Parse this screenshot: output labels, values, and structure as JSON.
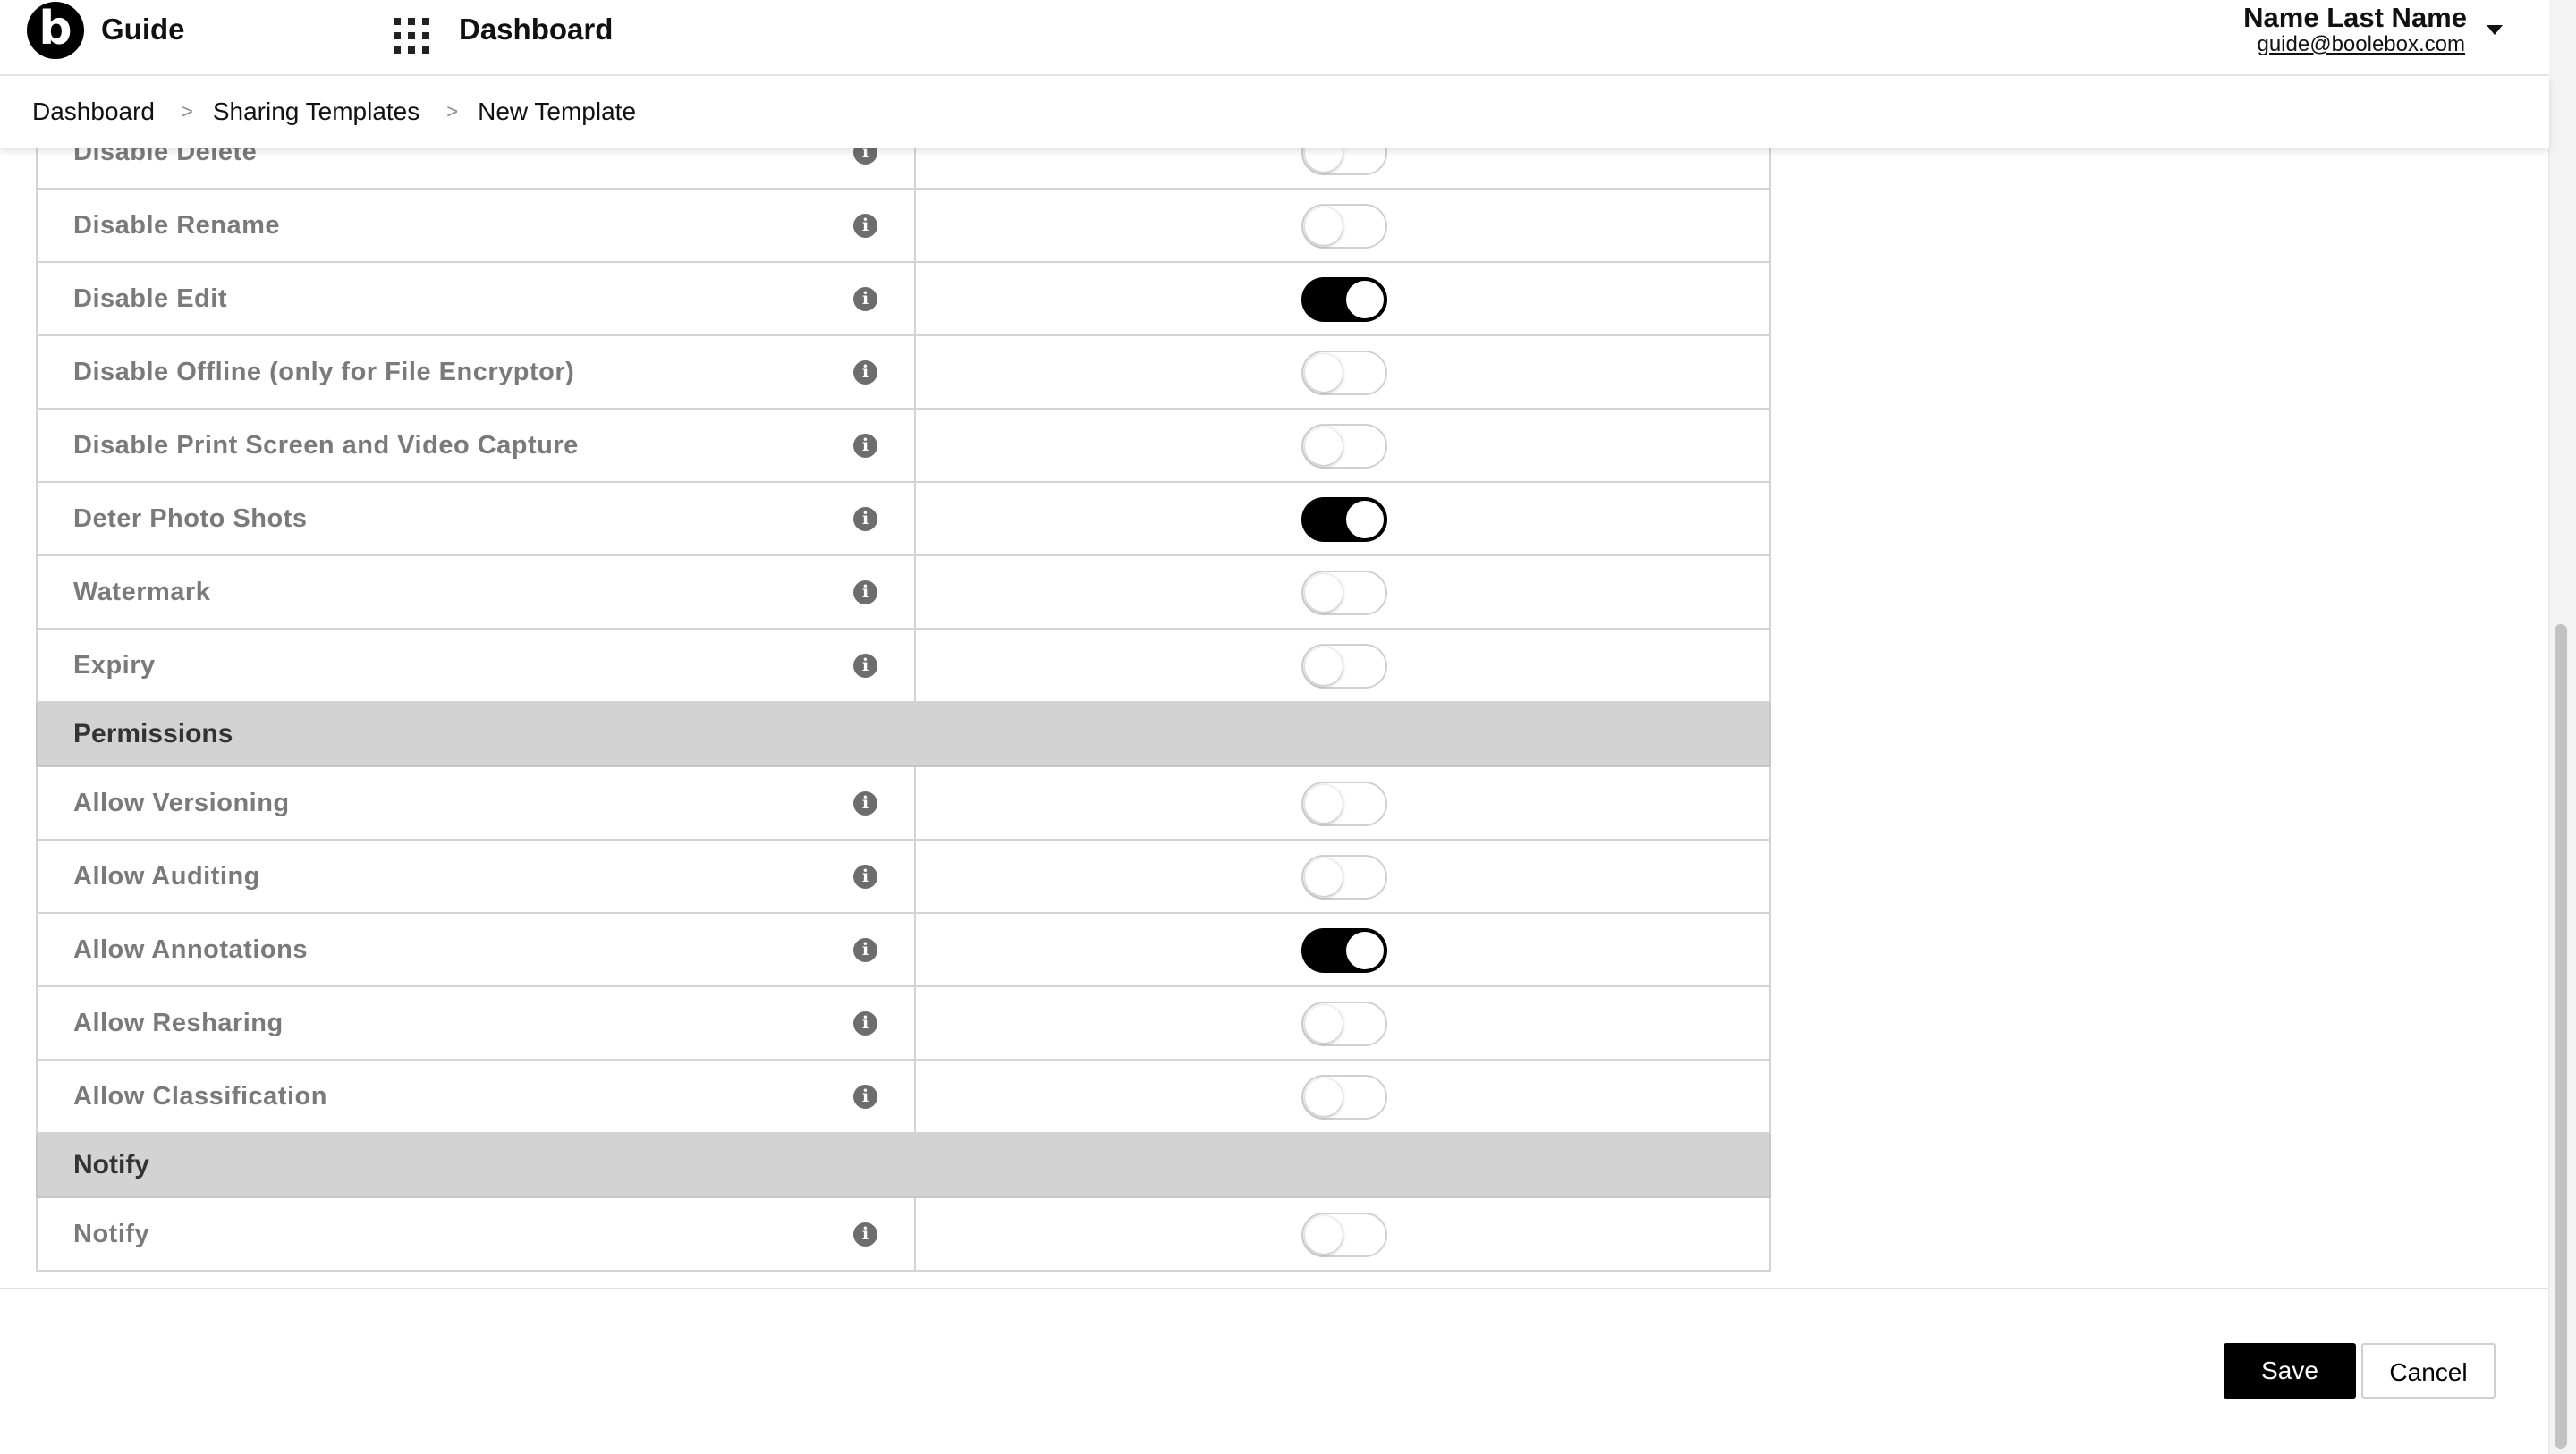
{
  "header": {
    "logo_letter": "b",
    "app_name": "Guide",
    "apps_icon": "apps-grid-icon",
    "nav_title": "Dashboard",
    "user_name": "Name Last Name",
    "user_email": "guide@boolebox.com"
  },
  "breadcrumb": {
    "items": [
      "Dashboard",
      "Sharing Templates",
      "New Template"
    ],
    "separator": ">"
  },
  "settings": {
    "info_glyph": "i",
    "options_partial": {
      "label": "Disable Delete",
      "enabled": false
    },
    "options": [
      {
        "label": "Disable Rename",
        "enabled": false
      },
      {
        "label": "Disable Edit",
        "enabled": true
      },
      {
        "label": "Disable Offline (only for File Encryptor)",
        "enabled": false
      },
      {
        "label": "Disable Print Screen and Video Capture",
        "enabled": false
      },
      {
        "label": "Deter Photo Shots",
        "enabled": true
      },
      {
        "label": "Watermark",
        "enabled": false
      },
      {
        "label": "Expiry",
        "enabled": false
      }
    ],
    "permissions_title": "Permissions",
    "permissions": [
      {
        "label": "Allow Versioning",
        "enabled": false
      },
      {
        "label": "Allow Auditing",
        "enabled": false
      },
      {
        "label": "Allow Annotations",
        "enabled": true
      },
      {
        "label": "Allow Resharing",
        "enabled": false
      },
      {
        "label": "Allow Classification",
        "enabled": false
      }
    ],
    "notify_title": "Notify",
    "notify": [
      {
        "label": "Notify",
        "enabled": false
      }
    ]
  },
  "footer": {
    "save_label": "Save",
    "cancel_label": "Cancel"
  },
  "colors": {
    "accent": "#000000",
    "section_bg": "#d3d3d3",
    "label_text": "#7a7a7a"
  }
}
